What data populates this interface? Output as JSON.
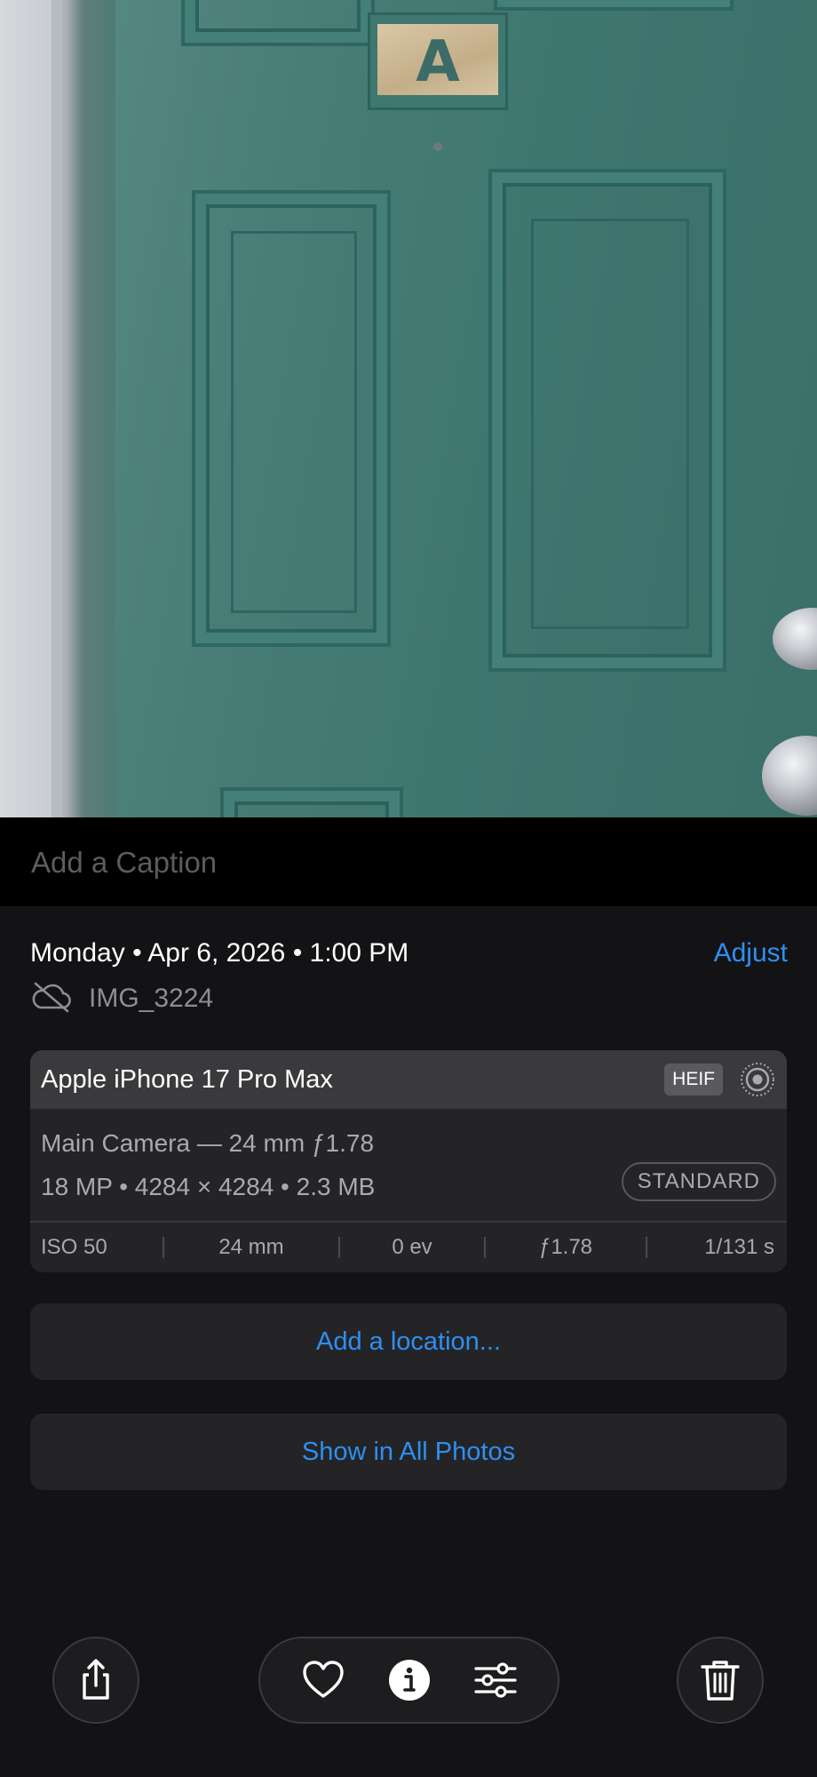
{
  "photo": {
    "plaque_letter": "A"
  },
  "caption": {
    "placeholder": "Add a Caption"
  },
  "info": {
    "date_line": "Monday • Apr 6, 2026 • 1:00 PM",
    "adjust_label": "Adjust",
    "file_name": "IMG_3224",
    "cloud_status_icon": "cloud-slash-icon"
  },
  "camera": {
    "device": "Apple iPhone 17 Pro Max",
    "format_badge": "HEIF",
    "live_icon": "live-photo-icon",
    "lens": "Main Camera — 24 mm ƒ1.78",
    "specs": "18 MP • 4284 × 4284 • 2.3 MB",
    "style_badge": "STANDARD",
    "exif": [
      "ISO 50",
      "24 mm",
      "0 ev",
      "ƒ1.78",
      "1/131 s"
    ]
  },
  "actions": {
    "add_location": "Add a location...",
    "show_in_all_photos": "Show in All Photos"
  },
  "toolbar": {
    "icons": [
      "share-icon",
      "heart-icon",
      "info-icon",
      "adjustments-icon",
      "trash-icon"
    ]
  },
  "colors": {
    "accent": "#2f8ff0",
    "background": "#131315",
    "card": "#242427",
    "card_header": "#3a3a3d",
    "secondary_text": "#a9a9ae"
  }
}
